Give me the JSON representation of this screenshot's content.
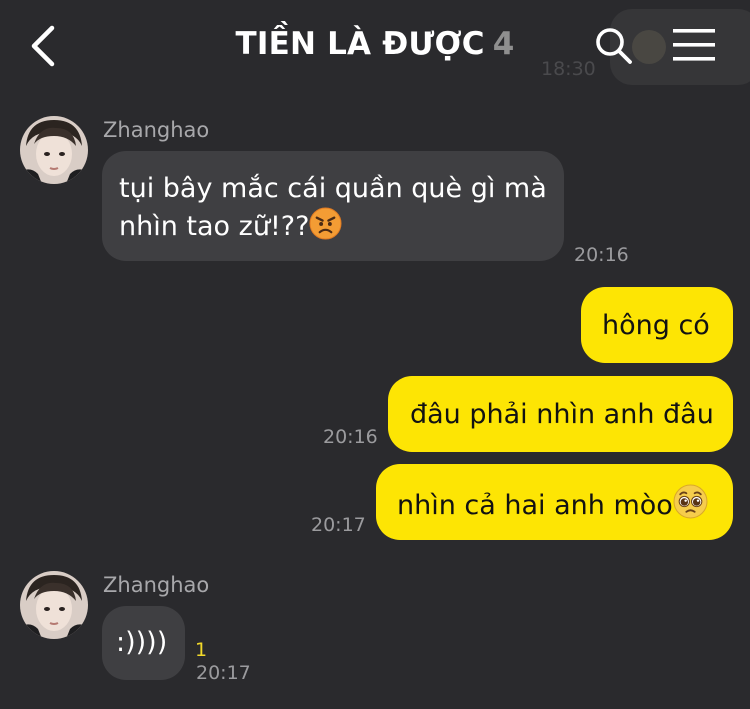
{
  "header": {
    "title": "TIỀN LÀ ĐƯỢC",
    "member_count": "4",
    "ghost_time": "18:30"
  },
  "messages": [
    {
      "sender": "Zhanghao",
      "text": "tụi bây mắc cái quần què gì mà",
      "text2": "nhìn tao zữ!??",
      "emoji": "angry-face-emoji",
      "time": "20:16"
    },
    {
      "text": "hông có"
    },
    {
      "text": "đâu phải nhìn anh đâu",
      "time": "20:16"
    },
    {
      "text": "nhìn cả hai anh mòo",
      "emoji": "pleading-face-emoji",
      "time": "20:17"
    },
    {
      "sender": "Zhanghao",
      "text": ":))))",
      "unread": "1",
      "time": "20:17"
    }
  ],
  "colors": {
    "background": "#2a2a2d",
    "incoming_bubble": "#3f3f42",
    "outgoing_bubble": "#fde504",
    "unread_count": "#f2d92a"
  }
}
